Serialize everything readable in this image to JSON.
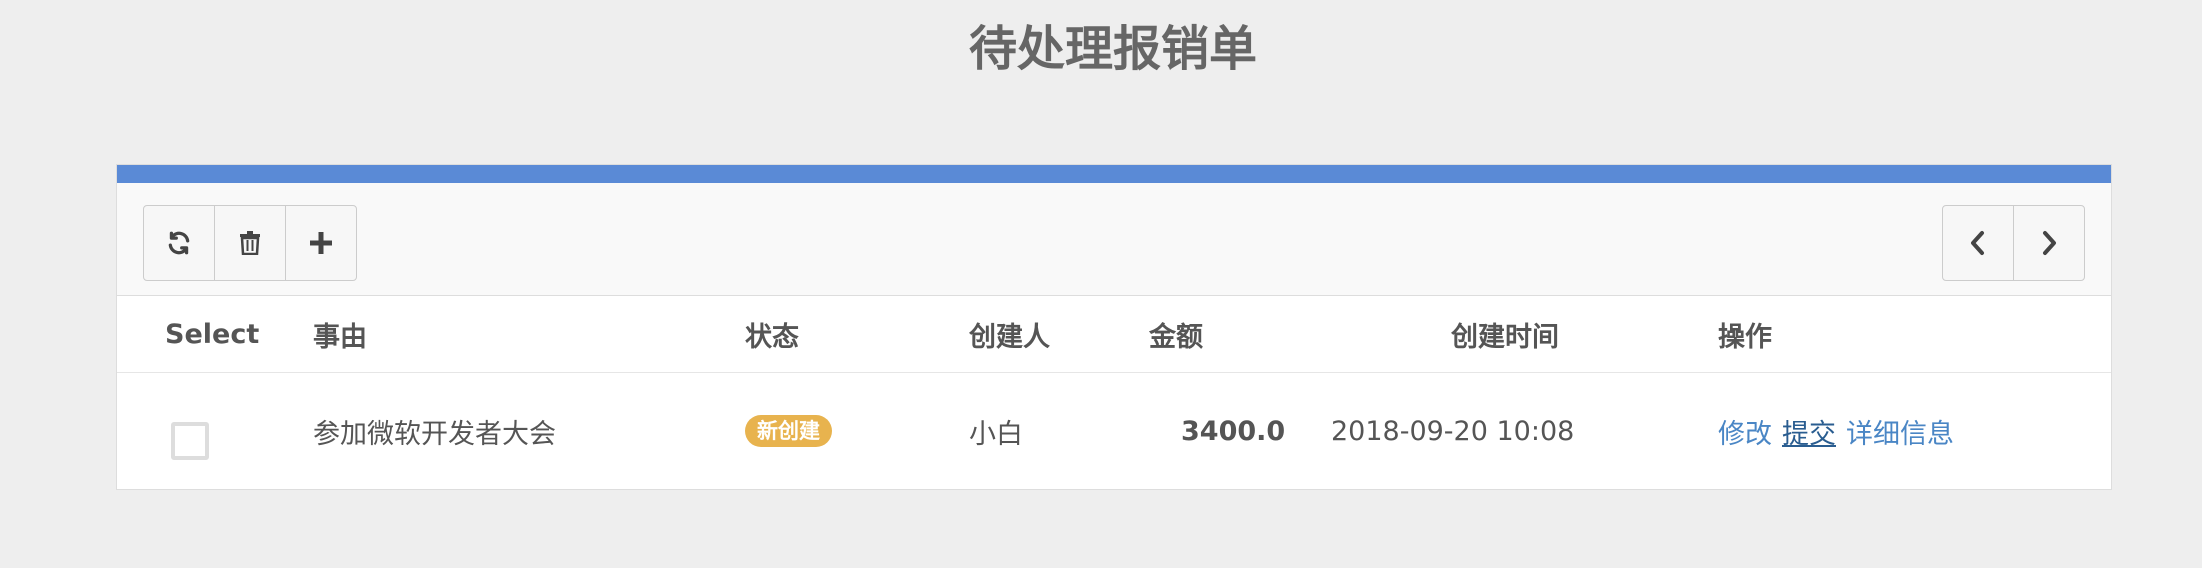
{
  "page": {
    "title": "待处理报销单"
  },
  "toolbar": {
    "left_buttons": [
      {
        "icon": "refresh-icon"
      },
      {
        "icon": "trash-icon"
      },
      {
        "icon": "plus-icon"
      }
    ],
    "right_buttons": [
      {
        "icon": "chevron-left-icon"
      },
      {
        "icon": "chevron-right-icon"
      }
    ]
  },
  "table": {
    "headers": {
      "select": "Select",
      "reason": "事由",
      "status": "状态",
      "creator": "创建人",
      "amount": "金额",
      "created_at": "创建时间",
      "actions": "操作"
    },
    "rows": [
      {
        "selected": false,
        "reason": "参加微软开发者大会",
        "status": "新创建",
        "creator": "小白",
        "amount": "3400.0",
        "created_at": "2018-09-20 10:08",
        "actions": {
          "edit": "修改",
          "submit": "提交",
          "details": "详细信息"
        }
      }
    ]
  },
  "colors": {
    "accent": "#5a8ad6",
    "badge": "#e8b34e",
    "link": "#4a86c5"
  }
}
